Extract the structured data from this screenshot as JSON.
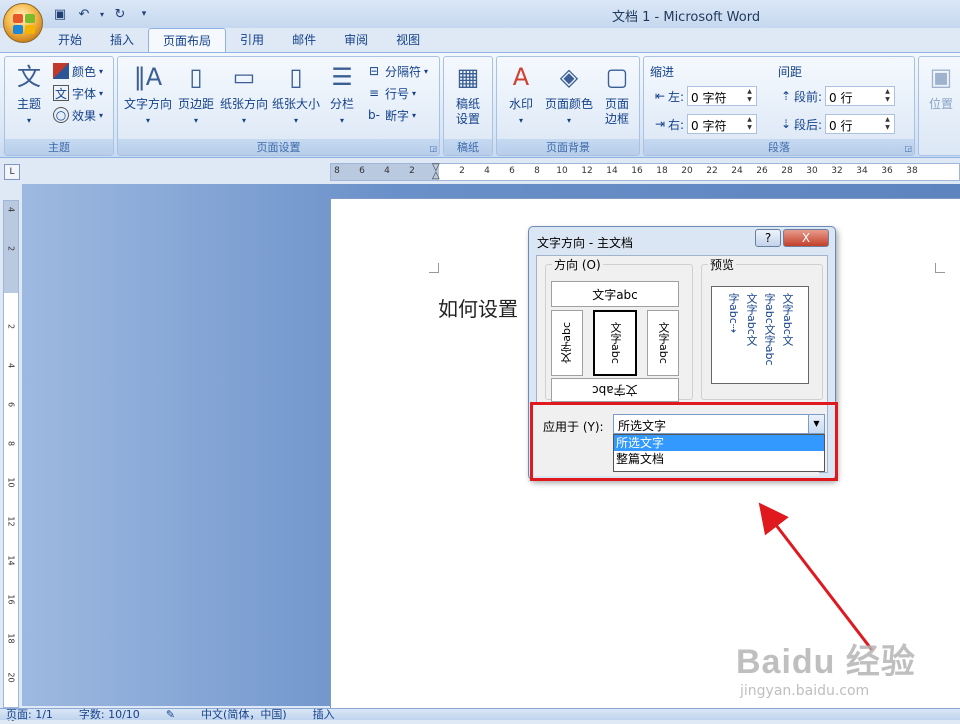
{
  "window": {
    "title": "文档 1 - Microsoft Word"
  },
  "qat": {
    "save_icon": "save-icon",
    "undo_icon": "undo-icon",
    "redo_icon": "redo-icon"
  },
  "tabs": [
    {
      "label": "开始"
    },
    {
      "label": "插入"
    },
    {
      "label": "页面布局",
      "active": true
    },
    {
      "label": "引用"
    },
    {
      "label": "邮件"
    },
    {
      "label": "审阅"
    },
    {
      "label": "视图"
    }
  ],
  "ribbon": {
    "theme": {
      "big": "主题",
      "colors": "颜色",
      "fonts": "字体",
      "effects": "效果",
      "label": "主题"
    },
    "page_setup": {
      "text_direction": "文字方向",
      "margins": "页边距",
      "orientation": "纸张方向",
      "size": "纸张大小",
      "columns": "分栏",
      "breaks": "分隔符",
      "line_numbers": "行号",
      "hyphenation": "断字",
      "label": "页面设置"
    },
    "draft": {
      "setup1": "稿纸",
      "setup2": "设置",
      "label": "稿纸"
    },
    "background": {
      "watermark": "水印",
      "page_color": "页面颜色",
      "page_borders1": "页面",
      "page_borders2": "边框",
      "label": "页面背景"
    },
    "paragraph": {
      "indent_title": "缩进",
      "spacing_title": "间距",
      "left_label": "左:",
      "left_value": "0 字符",
      "right_label": "右:",
      "right_value": "0 字符",
      "before_label": "段前:",
      "before_value": "0 行",
      "after_label": "段后:",
      "after_value": "0 行",
      "label": "段落"
    },
    "arrange": {
      "position": "位置"
    }
  },
  "ruler": {
    "corner": "L"
  },
  "document": {
    "text": "如何设置"
  },
  "dialog": {
    "title": "文字方向 - 主文档",
    "help": "?",
    "close": "X",
    "direction_legend": "方向 (O)",
    "preview_legend": "预览",
    "opt_horizontal": "文字abc",
    "opt_vertical_left": "文字abc",
    "opt_vertical_center": "文字abc",
    "opt_vertical_right": "文字abc",
    "opt_bottom": "文字abc",
    "preview_cols": [
      "文字abc文",
      "字abc文字abc",
      "文字abc文",
      "字abc⇢"
    ],
    "apply_label": "应用于 (Y):",
    "apply_value": "所选文字",
    "options": [
      "所选文字",
      "整篇文档"
    ]
  },
  "watermark": {
    "brand": "Baidu 经验",
    "url": "jingyan.baidu.com"
  },
  "status": {
    "page": "页面: 1/1",
    "words": "字数: 10/10",
    "lang": "中文(简体，中国)",
    "mode": "插入"
  }
}
